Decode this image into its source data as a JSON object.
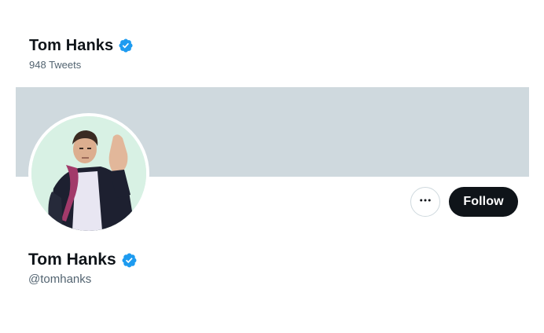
{
  "header": {
    "name": "Tom Hanks",
    "tweets_count": "948 Tweets",
    "verified_icon": "verified-badge-icon"
  },
  "banner": {
    "color": "#cfd9de"
  },
  "avatar": {
    "icon": "profile-photo"
  },
  "actions": {
    "more_icon": "more-horizontal-icon",
    "follow_label": "Follow"
  },
  "profile": {
    "name": "Tom Hanks",
    "handle": "@tomhanks",
    "verified_icon": "verified-badge-icon"
  },
  "colors": {
    "verified": "#1d9bf0",
    "text": "#0f1419",
    "secondary_text": "#536471",
    "follow_bg": "#0f1419"
  }
}
